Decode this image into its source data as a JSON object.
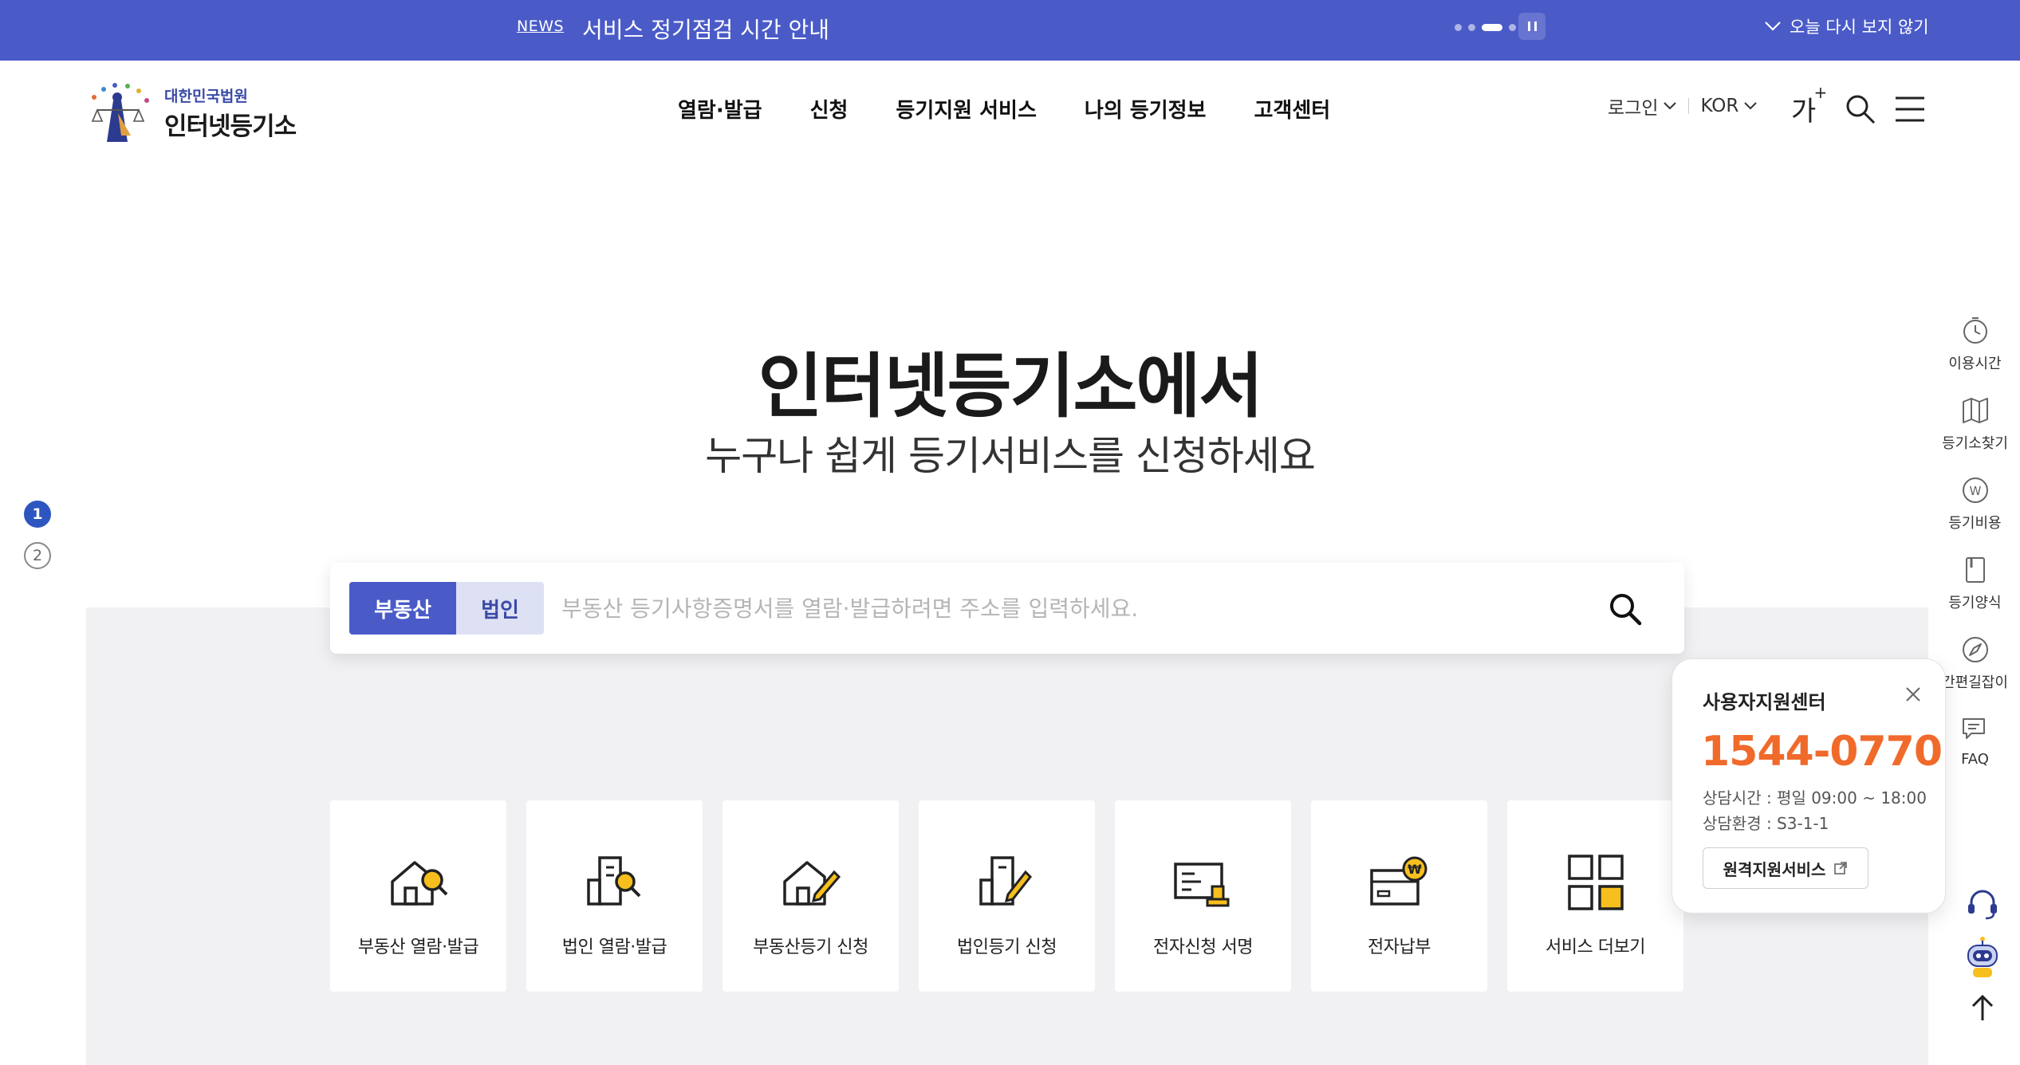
{
  "notice": {
    "tag": "NEWS",
    "text": "서비스 정기점검 시간 안내",
    "close_label": "오늘 다시 보지 않기"
  },
  "header": {
    "logo_sub": "대한민국법원",
    "logo_main": "인터넷등기소",
    "nav": [
      "열람·발급",
      "신청",
      "등기지원 서비스",
      "나의 등기정보",
      "고객센터"
    ],
    "login_label": "로그인",
    "lang_label": "KOR",
    "font_size_label": "가",
    "font_size_plus": "+"
  },
  "hero": {
    "title": "인터넷등기소에서",
    "subtitle": "누구나 쉽게 등기서비스를 신청하세요",
    "slides": [
      "1",
      "2"
    ]
  },
  "search": {
    "tab_real_estate": "부동산",
    "tab_corporation": "법인",
    "placeholder": "부동산 등기사항증명서를 열람·발급하려면 주소를 입력하세요."
  },
  "services": [
    {
      "label": "부동산 열람·발급",
      "icon": "house-search-icon"
    },
    {
      "label": "법인 열람·발급",
      "icon": "building-search-icon"
    },
    {
      "label": "부동산등기 신청",
      "icon": "house-pen-icon"
    },
    {
      "label": "법인등기 신청",
      "icon": "building-pen-icon"
    },
    {
      "label": "전자신청 서명",
      "icon": "signature-icon"
    },
    {
      "label": "전자납부",
      "icon": "payment-icon"
    },
    {
      "label": "서비스 더보기",
      "icon": "grid-icon"
    }
  ],
  "quick_menu": [
    {
      "label": "이용시간",
      "icon": "clock-icon"
    },
    {
      "label": "등기소찾기",
      "icon": "map-icon"
    },
    {
      "label": "등기비용",
      "icon": "won-icon"
    },
    {
      "label": "등기양식",
      "icon": "document-icon"
    },
    {
      "label": "간편길잡이",
      "icon": "compass-icon"
    },
    {
      "label": "FAQ",
      "icon": "chat-icon"
    }
  ],
  "support": {
    "title": "사용자지원센터",
    "phone": "1544-0770",
    "hours": "상담시간 : 평일 09:00 ~ 18:00",
    "env": "상담환경 : S3-1-1",
    "button": "원격지원서비스"
  },
  "colors": {
    "primary": "#4a5bc8",
    "accent": "#f06a2c",
    "icon_yellow": "#f7bf1e"
  }
}
